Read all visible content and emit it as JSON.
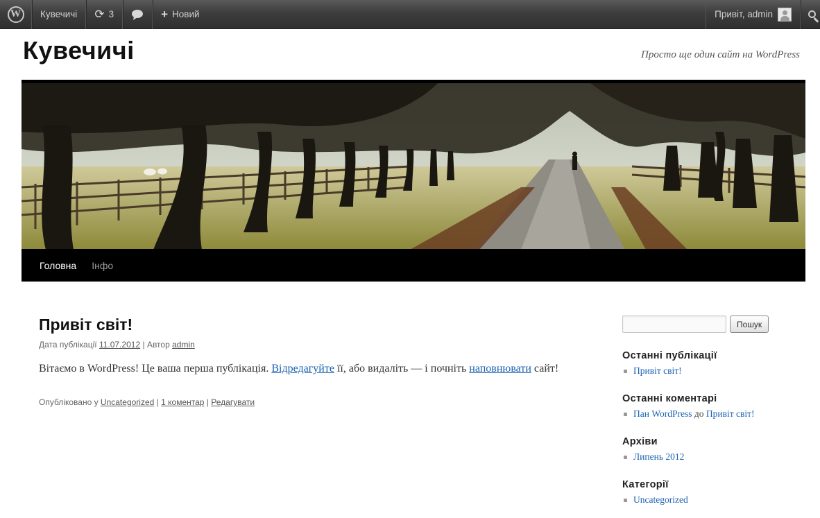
{
  "adminbar": {
    "site_name": "Кувечичі",
    "updates_count": "3",
    "new_label": "Новий",
    "greeting": "Привіт, admin"
  },
  "header": {
    "title": "Кувечичі",
    "description": "Просто ще один сайт на WordPress"
  },
  "nav": {
    "items": [
      {
        "label": "Головна"
      },
      {
        "label": "Інфо"
      }
    ]
  },
  "post": {
    "title": "Привіт світ!",
    "meta": {
      "date_prefix": "Дата публікації",
      "date": "11.07.2012",
      "separator": "|",
      "author_prefix": "Автор",
      "author": "admin"
    },
    "body": {
      "part1": "Вітаємо в WordPress! Це ваша перша публікація. ",
      "link1": "Відредагуйте",
      "part2": " її, або видаліть — і почніть ",
      "link2": "наповнювати",
      "part3": " сайт!"
    },
    "footer": {
      "published_prefix": "Опубліковано у",
      "category": "Uncategorized",
      "separator": "|",
      "comments": "1 коментар",
      "edit": "Редагувати"
    }
  },
  "sidebar": {
    "search_button": "Пошук",
    "recent_posts": {
      "title": "Останні публікації",
      "items": [
        "Привіт світ!"
      ]
    },
    "recent_comments": {
      "title": "Останні коментарі",
      "author": "Пан WordPress",
      "conjunction": "до",
      "post": "Привіт світ!"
    },
    "archives": {
      "title": "Архіви",
      "items": [
        "Липень 2012"
      ]
    },
    "categories": {
      "title": "Категорії",
      "items": [
        "Uncategorized"
      ]
    }
  },
  "icons": {
    "wp_logo": "wordpress-logo-icon",
    "updates": "refresh-icon",
    "comments": "comment-bubble-icon",
    "new": "plus-icon",
    "avatar": "user-avatar-icon",
    "search": "search-icon"
  },
  "colors": {
    "adminbar_bg": "#464646",
    "link": "#1b62b1",
    "nav_bg": "#000000"
  }
}
